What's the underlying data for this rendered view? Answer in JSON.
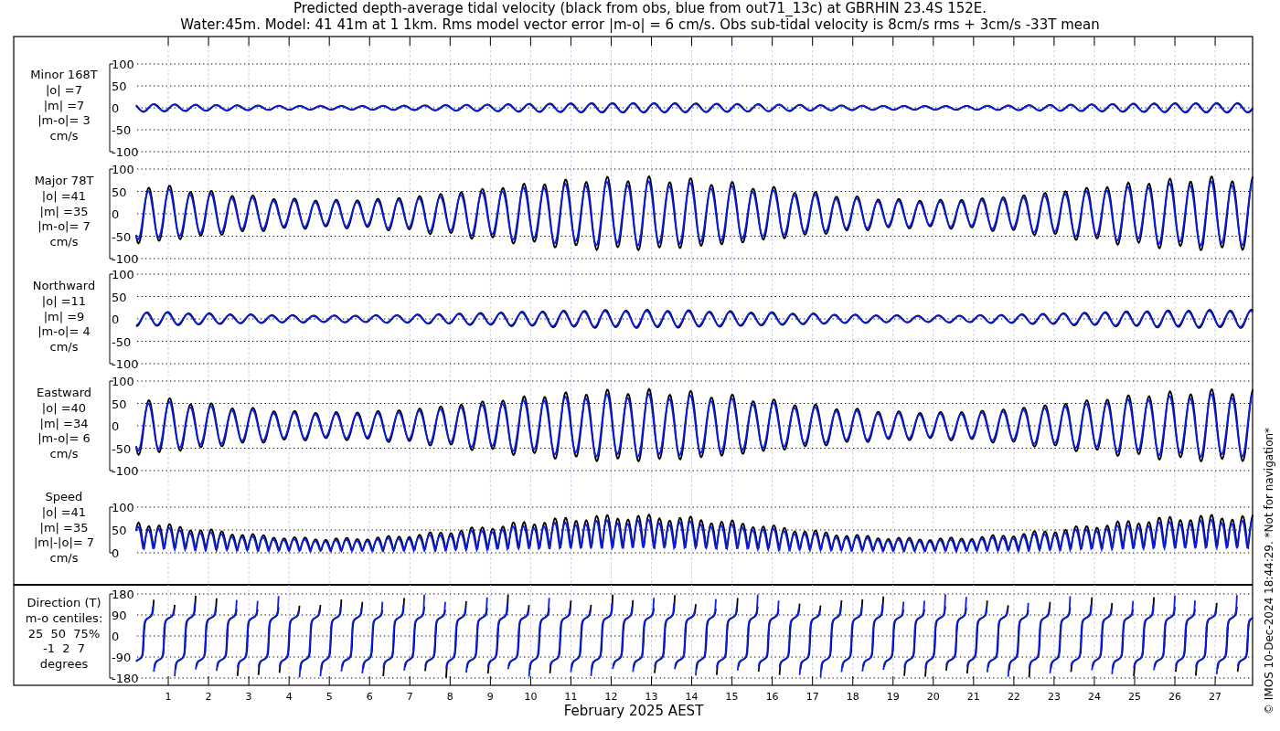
{
  "title_lines": [
    "Predicted depth-average tidal velocity (black from obs, blue from out71_13c) at GBRHIN 23.4S 152E.",
    "Water:45m. Model: 41 41m at 1 1km. Rms model vector error |m-o| = 6 cm/s. Obs sub-tidal velocity is 8cm/s rms + 3cm/s -33T mean"
  ],
  "panels": [
    {
      "kind": "minor",
      "label_lines": [
        "Minor 168T",
        "|o| =7",
        "|m| =7",
        "|m-o|= 3",
        "cm/s"
      ],
      "yticks": [
        "100",
        "50",
        "0",
        "-50",
        "-100"
      ]
    },
    {
      "kind": "major",
      "label_lines": [
        "Major 78T",
        "|o| =41",
        "|m| =35",
        "|m-o|= 7",
        "cm/s"
      ],
      "yticks": [
        "100",
        "50",
        "0",
        "-50",
        "-100"
      ]
    },
    {
      "kind": "north",
      "label_lines": [
        "Northward",
        "|o| =11",
        "|m| =9",
        "|m-o|= 4",
        "cm/s"
      ],
      "yticks": [
        "100",
        "50",
        "0",
        "-50",
        "-100"
      ]
    },
    {
      "kind": "east",
      "label_lines": [
        "Eastward",
        "|o| =40",
        "|m| =34",
        "|m-o|= 6",
        "cm/s"
      ],
      "yticks": [
        "100",
        "50",
        "0",
        "-50",
        "-100"
      ]
    },
    {
      "kind": "speed",
      "label_lines": [
        "Speed",
        "|o| =41",
        "|m| =35",
        "|m|-|o|= 7",
        "cm/s"
      ],
      "yticks": [
        "100",
        "50",
        "0"
      ]
    },
    {
      "kind": "direction",
      "label_lines": [
        "Direction (T)",
        "m-o centiles:",
        "25  50  75%",
        "-1  2  7",
        "degrees"
      ],
      "yticks": [
        "180",
        "90",
        "0",
        "-90",
        "-180"
      ]
    }
  ],
  "xticks": [
    "1",
    "2",
    "3",
    "4",
    "5",
    "6",
    "7",
    "8",
    "9",
    "10",
    "11",
    "12",
    "13",
    "14",
    "15",
    "16",
    "17",
    "18",
    "19",
    "20",
    "21",
    "22",
    "23",
    "24",
    "25",
    "26",
    "27"
  ],
  "xlabel": "February 2025 AEST",
  "credit": "© IMOS 10-Dec-2024 18:44:29. *Not for navigation*"
}
